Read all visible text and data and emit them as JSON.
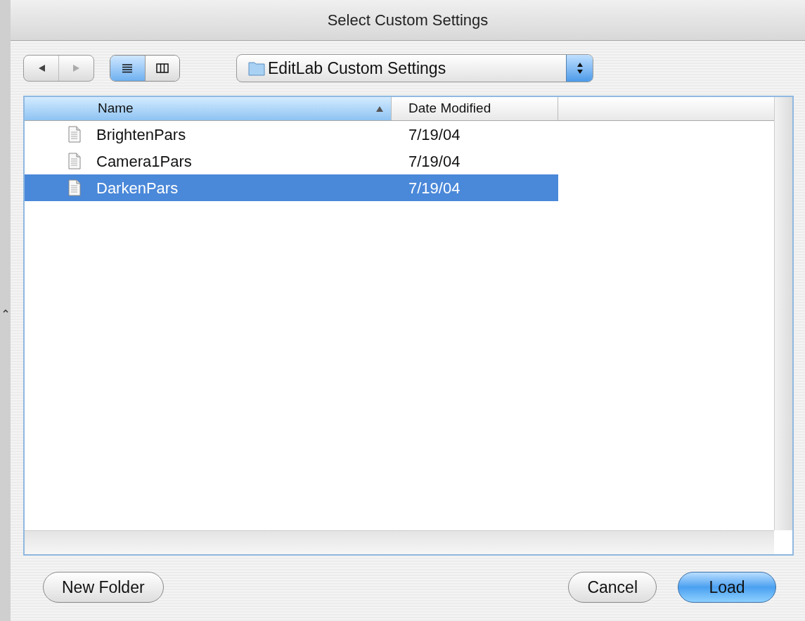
{
  "window": {
    "title": "Select Custom Settings"
  },
  "toolbar": {
    "view_modes": [
      {
        "kind": "list",
        "selected": true
      },
      {
        "kind": "columns",
        "selected": false
      }
    ],
    "location": "EditLab Custom Settings"
  },
  "table": {
    "columns": [
      {
        "label": "Name",
        "selected": true
      },
      {
        "label": "Date Modified",
        "selected": false
      }
    ],
    "rows": [
      {
        "name": "BrightenPars",
        "date": "7/19/04",
        "selected": false
      },
      {
        "name": "Camera1Pars",
        "date": "7/19/04",
        "selected": false
      },
      {
        "name": "DarkenPars",
        "date": "7/19/04",
        "selected": true
      }
    ]
  },
  "buttons": [
    {
      "label": "New Folder",
      "kind": "normal"
    },
    {
      "label": "Cancel",
      "kind": "normal"
    },
    {
      "label": "Load",
      "kind": "default"
    }
  ]
}
